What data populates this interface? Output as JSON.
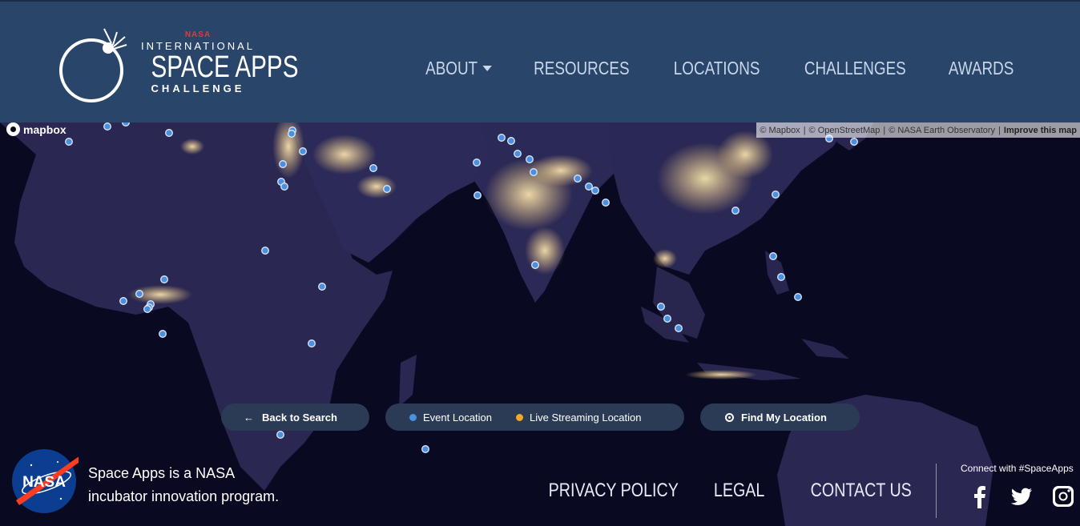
{
  "header": {
    "logo": {
      "nasa": "NASA",
      "international": "INTERNATIONAL",
      "space_apps": "SPACE APPS",
      "challenge": "CHALLENGE"
    },
    "nav": {
      "about": "ABOUT",
      "resources": "RESOURCES",
      "locations": "LOCATIONS",
      "challenges": "CHALLENGES",
      "awards": "AWARDS"
    }
  },
  "map": {
    "brand": "mapbox",
    "attribution": {
      "mapbox": "© Mapbox",
      "osm": "© OpenStreetMap",
      "nasa": "© NASA Earth Observatory",
      "improve": "Improve this map"
    },
    "controls": {
      "back": "Back to Search",
      "back_arrow": "←",
      "legend_event": "Event Location",
      "legend_live": "Live Streaming Location",
      "find": "Find My Location"
    },
    "colors": {
      "event": "#4a8fe0",
      "live": "#f5a623",
      "land": "#2a2753",
      "ocean": "#0a0922"
    }
  },
  "footer": {
    "tagline_line1": "Space Apps is a NASA",
    "tagline_line2": "incubator innovation program.",
    "meatball_text": "NASA",
    "links": {
      "privacy": "PRIVACY POLICY",
      "legal": "LEGAL",
      "contact": "CONTACT US"
    },
    "connect": "Connect with #SpaceApps",
    "social": [
      "facebook-icon",
      "twitter-icon",
      "instagram-icon"
    ]
  }
}
